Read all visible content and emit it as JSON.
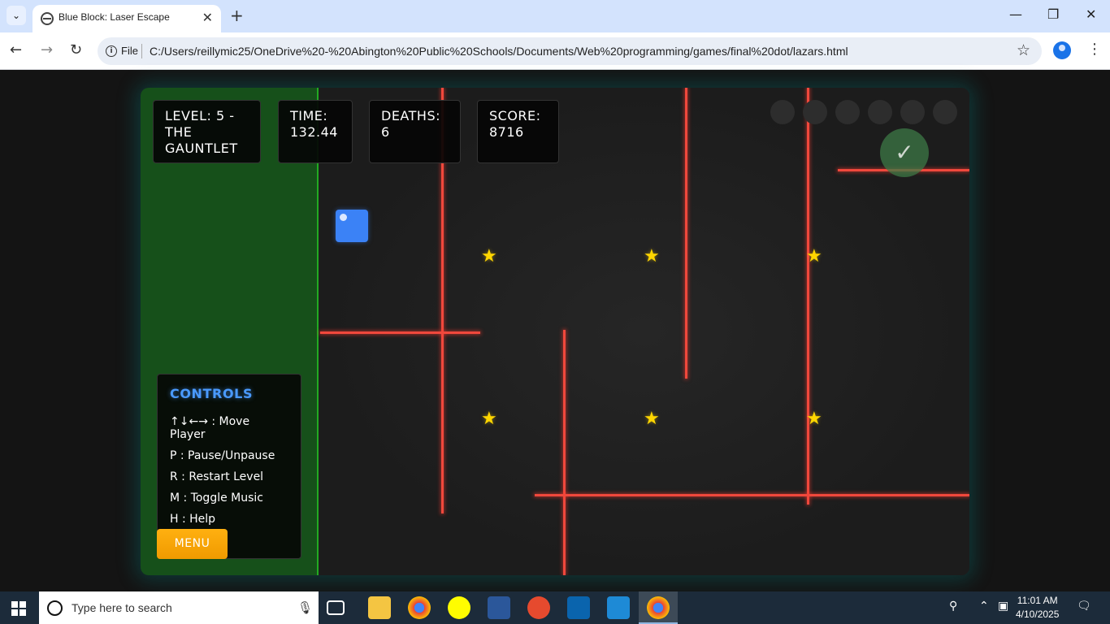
{
  "browser": {
    "tab_title": "Blue Block: Laser Escape",
    "tab_close": "✕",
    "new_tab": "+",
    "file_label": "File",
    "url": "C:/Users/reillymic25/OneDrive%20-%20Abington%20Public%20Schools/Documents/Web%20programming/games/final%20dot/lazars.html",
    "minimize": "—",
    "restore": "❐",
    "close": "✕"
  },
  "hud": {
    "level": "LEVEL: 5 - THE GAUNTLET",
    "time": "TIME: 132.44",
    "deaths": "DEATHS: 6",
    "score": "SCORE: 8716"
  },
  "goal": {
    "symbol": "✓"
  },
  "stars": {
    "symbol": "★"
  },
  "controls": {
    "title": "CONTROLS",
    "items": [
      "↑↓←→ : Move Player",
      "P : Pause/Unpause",
      "R : Restart Level",
      "M : Toggle Music",
      "H : Help"
    ]
  },
  "menu_label": "MENU",
  "taskbar": {
    "search_placeholder": "Type here to search",
    "time": "11:01 AM",
    "date": "4/10/2025"
  },
  "colors": {
    "laser": "#f0483c",
    "player": "#3b82f6",
    "star": "#ffd600",
    "start_zone": "#16501a",
    "menu_button": "#f5a100",
    "controls_title": "#4a9aff"
  }
}
